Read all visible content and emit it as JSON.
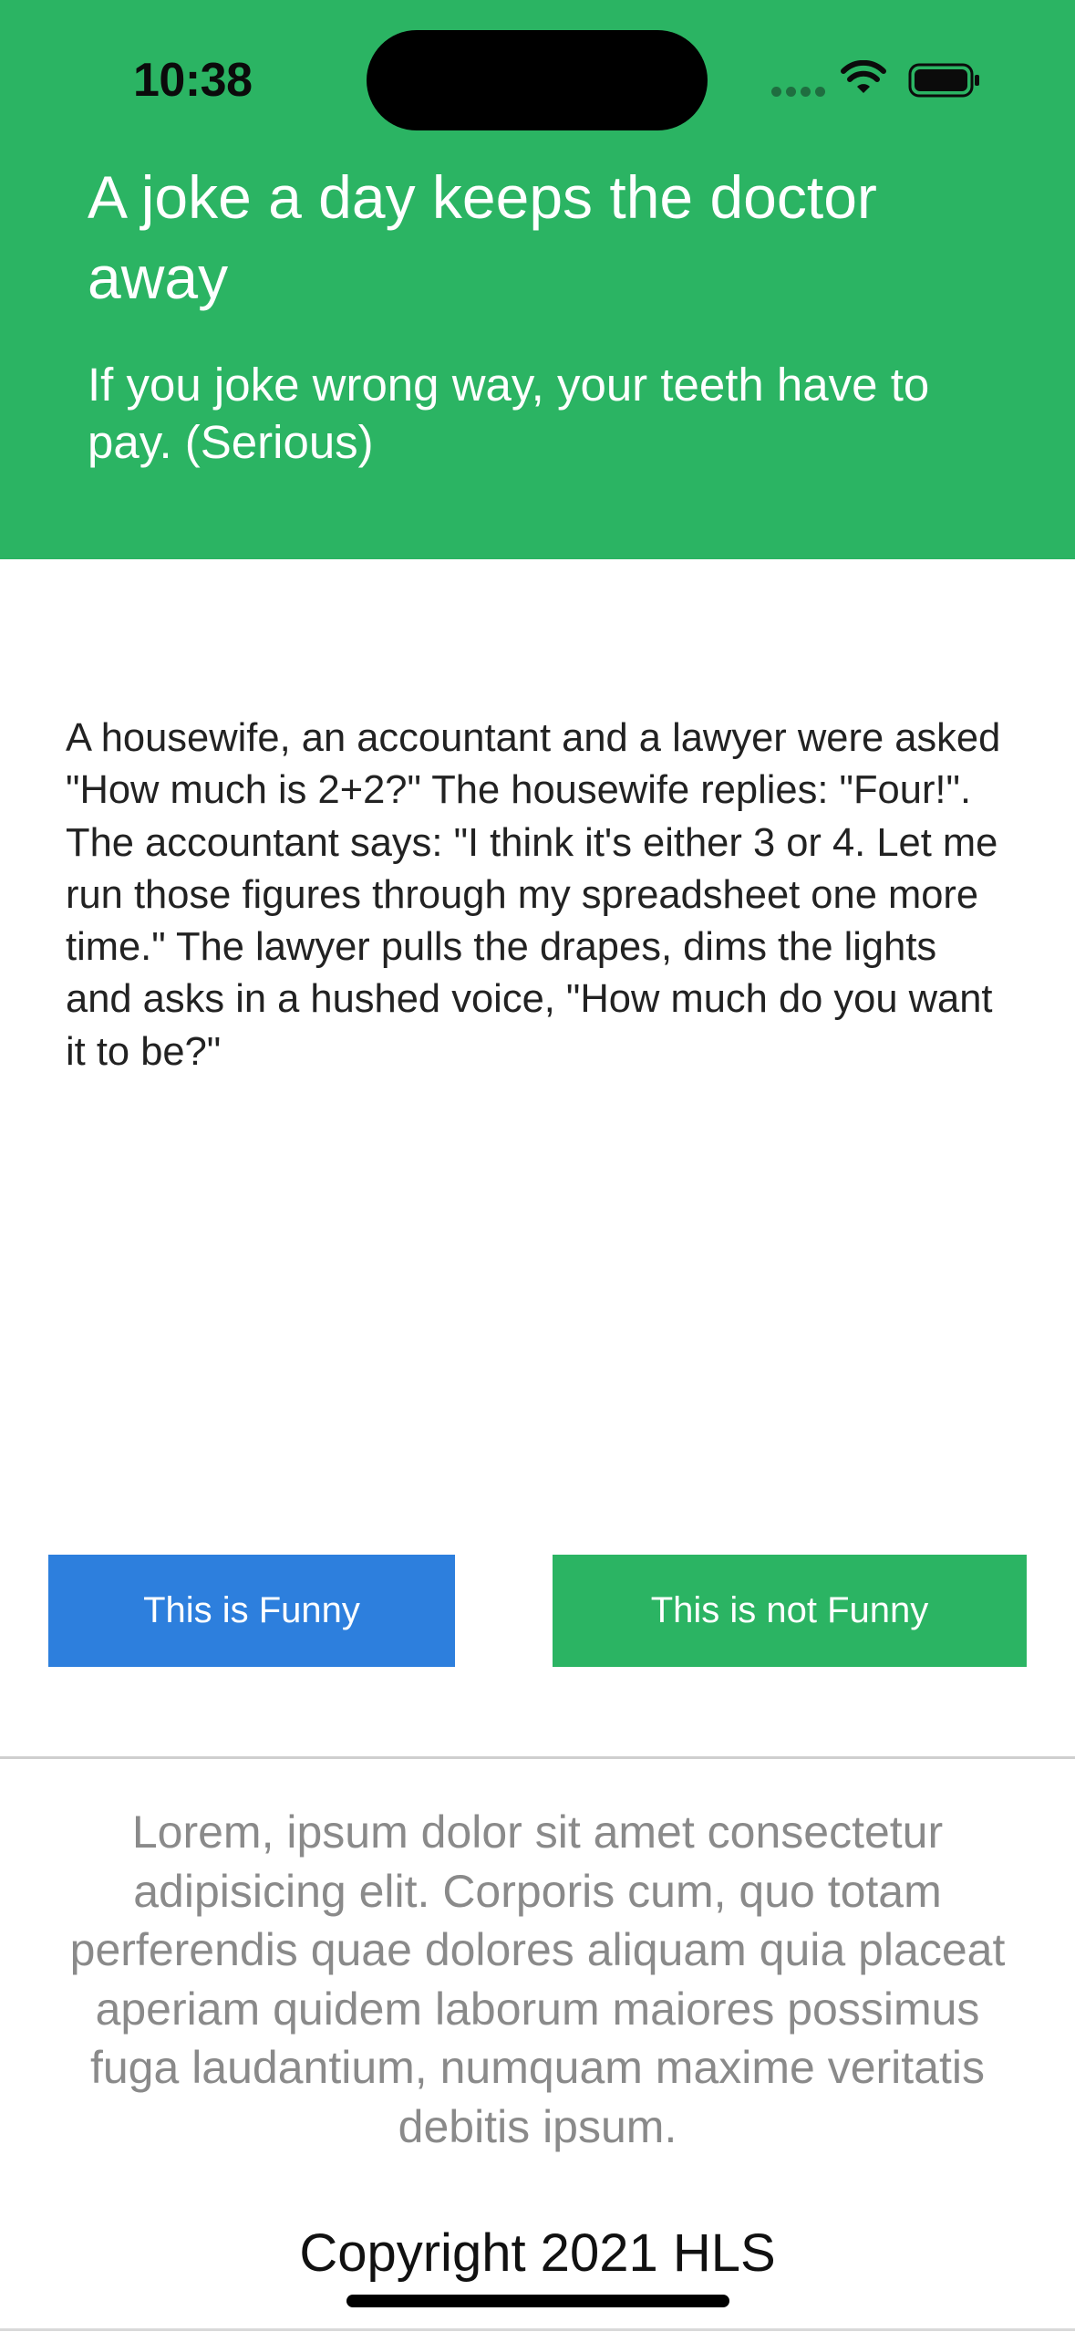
{
  "status_bar": {
    "time": "10:38",
    "icons": [
      "cellular-signal-icon",
      "wifi-icon",
      "battery-icon"
    ]
  },
  "header": {
    "title": "A joke a day keeps the doctor away",
    "subtitle": "If you joke wrong way, your teeth have to pay. (Serious)",
    "background_color": "#2bb463"
  },
  "joke": {
    "text": "A housewife, an accountant and a lawyer were asked \"How much is 2+2?\" The housewife replies: \"Four!\". The accountant says: \"I think it's either 3 or 4. Let me run those figures through my spreadsheet one more time.\" The lawyer pulls the drapes, dims the lights and asks in a hushed voice, \"How much do you want it to be?\""
  },
  "actions": {
    "funny_label": "This is Funny",
    "funny_color": "#2d7fdd",
    "not_funny_label": "This is not Funny",
    "not_funny_color": "#2bb463"
  },
  "footer": {
    "description": "Lorem, ipsum dolor sit amet consectetur adipisicing elit. Corporis cum, quo totam perferendis quae dolores aliquam quia placeat aperiam quidem laborum maiores possimus fuga laudantium, numquam maxime veritatis debitis ipsum.",
    "copyright": "Copyright 2021 HLS"
  }
}
